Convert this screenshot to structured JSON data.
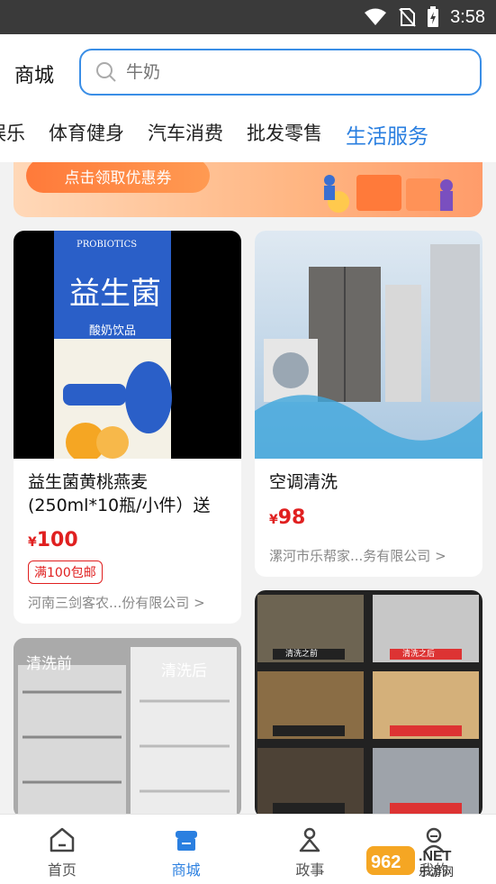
{
  "status": {
    "time": "3:58"
  },
  "header": {
    "title": "商城",
    "search_placeholder": "牛奶"
  },
  "tabs": [
    "娱乐",
    "体育健身",
    "汽车消费",
    "批发零售",
    "生活服务"
  ],
  "banner": {
    "button_label": "点击领取优惠券"
  },
  "products": [
    {
      "title": "益生菌黄桃燕麦(250ml*10瓶/小件）送",
      "price": "100",
      "currency": "¥",
      "badge": "满100包邮",
      "shop": "河南三剑客农...份有限公司 >",
      "image_texts": {
        "brand": "益生菌",
        "sub": "酸奶饮品",
        "en": "PROBIOTICS"
      }
    },
    {
      "title": "空调清洗",
      "price": "98",
      "currency": "¥",
      "shop": "漯河市乐帮家...务有限公司 >"
    },
    {
      "image_texts": {
        "before": "清洗前",
        "after": "清洗后"
      }
    },
    {
      "image_texts": {
        "before": "清洗之前",
        "after": "清洗之后"
      }
    }
  ],
  "bottom_nav": [
    {
      "label": "首页",
      "icon": "home-icon"
    },
    {
      "label": "商城",
      "icon": "store-icon"
    },
    {
      "label": "政事",
      "icon": "person-icon"
    },
    {
      "label": "我的",
      "icon": "user-icon"
    }
  ],
  "colors": {
    "accent": "#2a7fe0",
    "price": "#e02020",
    "banner": "#ff9c6a"
  },
  "watermark": "962.NET 乐游网"
}
